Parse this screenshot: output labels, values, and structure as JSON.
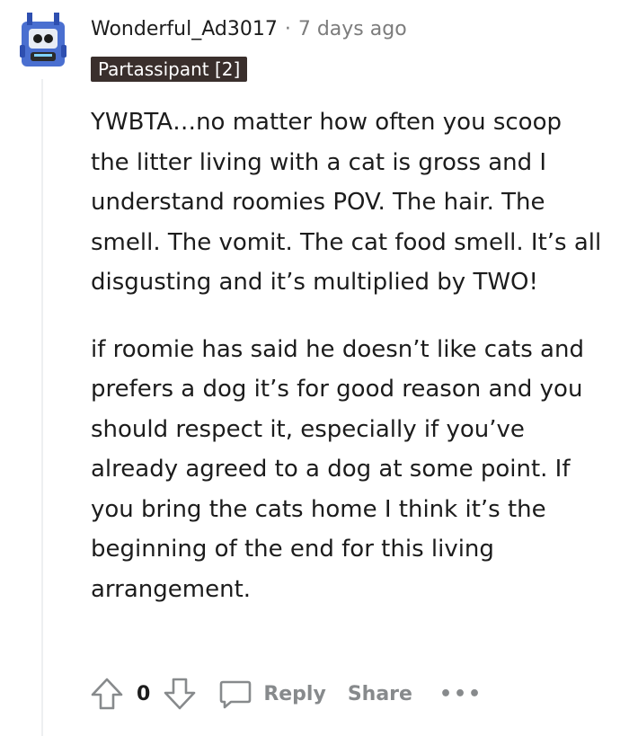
{
  "comment": {
    "username": "Wonderful_Ad3017",
    "separator": "·",
    "timestamp": "7 days ago",
    "flair": "Partassipant [2]",
    "paragraphs": [
      "YWBTA…no matter how often you scoop the litter living with a cat is gross and I understand roomies POV. The hair. The smell. The vomit. The cat food smell. It’s all disgusting and it’s multiplied by TWO!",
      "if roomie has said he doesn’t like cats and prefers a dog it’s for good reason and you should respect it, especially if you’ve already agreed to a dog at some point. If you bring the cats home I think it’s the beginning of the end for this living arrangement."
    ],
    "vote_count": "0",
    "reply_label": "Reply",
    "share_label": "Share",
    "more_label": "•••"
  },
  "icons": {
    "avatar": "snoo-avatar-icon",
    "upvote": "arrow-up-icon",
    "downvote": "arrow-down-icon",
    "reply": "speech-bubble-icon",
    "more": "more-options-icon"
  },
  "colors": {
    "flair_bg": "#3a2f2c",
    "muted": "#878a8c",
    "text": "#1c1c1c",
    "avatar_blue": "#4a6fd0"
  }
}
